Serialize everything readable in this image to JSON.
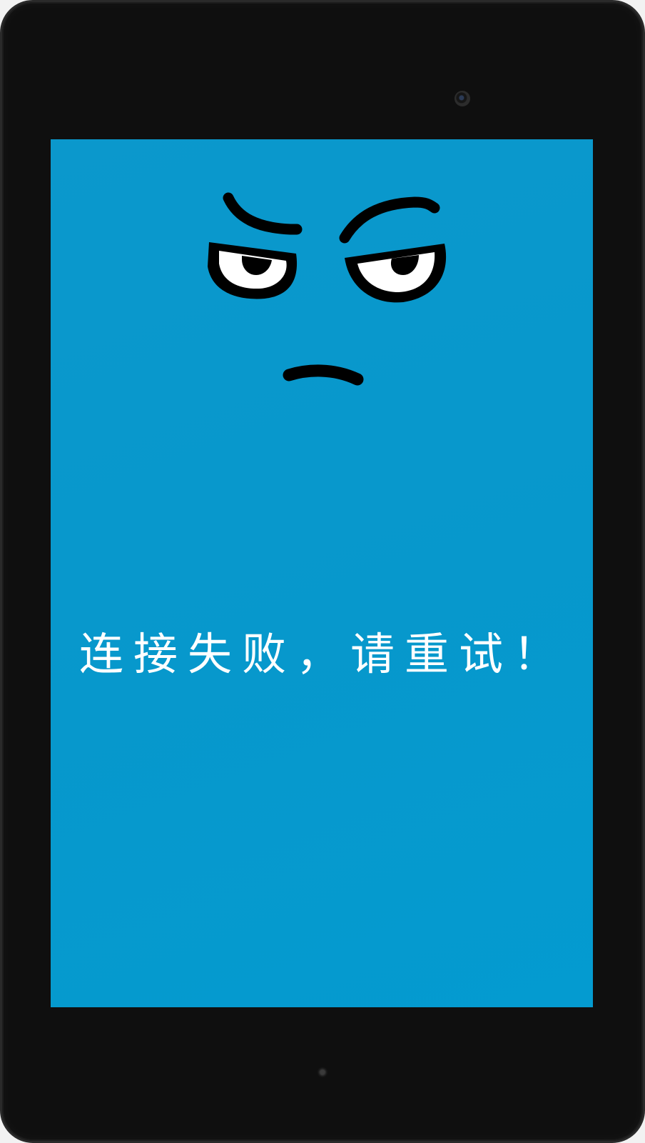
{
  "screen": {
    "background": "#0798cc",
    "message": "连接失败，请重试！",
    "message_color": "#ffffff",
    "illustration": "annoyed-face-icon"
  },
  "device": {
    "frame_color": "#0f0f0f"
  }
}
